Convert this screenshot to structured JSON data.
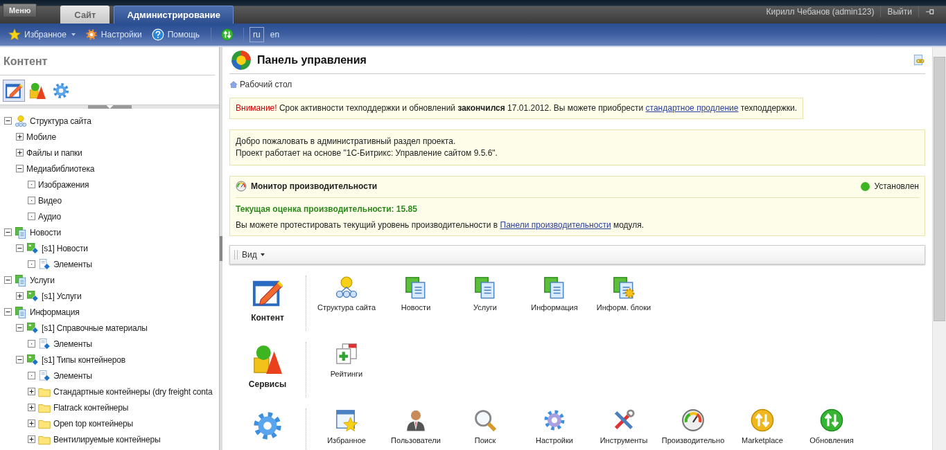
{
  "top_bar": {
    "menu_button": "Меню",
    "tabs": [
      {
        "label": "Сайт",
        "selected": false
      },
      {
        "label": "Администрирование",
        "selected": true
      }
    ],
    "user": "Кирилл Чебанов (admin123)",
    "logout": "Выйти"
  },
  "toolbar": {
    "items": [
      {
        "kind": "favorites",
        "label": "Избранное",
        "dropdown": true
      },
      {
        "kind": "settings",
        "label": "Настройки",
        "dropdown": false
      },
      {
        "kind": "help",
        "label": "Помощь",
        "dropdown": false
      }
    ],
    "languages": [
      {
        "label": "ru",
        "selected": true
      },
      {
        "label": "en",
        "selected": false
      }
    ]
  },
  "sidebar": {
    "title": "Контент",
    "modes": [
      {
        "kind": "content",
        "selected": true
      },
      {
        "kind": "services",
        "selected": false
      },
      {
        "kind": "settings",
        "selected": false
      }
    ],
    "tree": [
      {
        "label": "Структура сайта",
        "kind": "structure",
        "expanded": true,
        "children": [
          {
            "label": "Мобиле",
            "kind": "plain",
            "expanded": false
          },
          {
            "label": "Файлы и папки",
            "kind": "plain",
            "expanded": false
          },
          {
            "label": "Медиабиблиотека",
            "kind": "plain",
            "expanded": true,
            "children": [
              {
                "label": "Изображения",
                "kind": "plain",
                "leaf": true
              },
              {
                "label": "Видео",
                "kind": "plain",
                "leaf": true
              },
              {
                "label": "Аудио",
                "kind": "plain",
                "leaf": true
              }
            ]
          }
        ]
      },
      {
        "label": "Новости",
        "kind": "iblock-type",
        "expanded": true,
        "children": [
          {
            "label": "[s1] Новости",
            "kind": "iblock",
            "expanded": true,
            "children": [
              {
                "label": "Элементы",
                "kind": "elements",
                "leaf": true
              }
            ]
          }
        ]
      },
      {
        "label": "Услуги",
        "kind": "iblock-type",
        "expanded": true,
        "children": [
          {
            "label": "[s1] Услуги",
            "kind": "iblock",
            "expanded": false
          }
        ]
      },
      {
        "label": "Информация",
        "kind": "iblock-type",
        "expanded": true,
        "children": [
          {
            "label": "[s1] Справочные материалы",
            "kind": "iblock",
            "expanded": true,
            "children": [
              {
                "label": "Элементы",
                "kind": "elements",
                "leaf": true
              }
            ]
          },
          {
            "label": "[s1] Типы контейнеров",
            "kind": "iblock",
            "expanded": true,
            "children": [
              {
                "label": "Элементы",
                "kind": "elements",
                "leaf": true
              },
              {
                "label": "Стандартные контейнеры (dry freight conta",
                "kind": "section",
                "expanded": false
              },
              {
                "label": "Flatrack контейнеры",
                "kind": "section",
                "expanded": false
              },
              {
                "label": "Open top контейнеры",
                "kind": "section",
                "expanded": false
              },
              {
                "label": "Вентилируемые контейнеры",
                "kind": "section",
                "expanded": false
              }
            ]
          }
        ]
      }
    ]
  },
  "main": {
    "title": "Панель управления",
    "breadcrumb": "Рабочий стол",
    "warning": {
      "label": "Внимание!",
      "text": "Срок активности техподдержки и обновлений **закончился** 17.01.2012. Вы можете приобрести",
      "link": "стандартное продление",
      "text_after": "техподдержки."
    },
    "welcome": [
      "Добро пожаловать в административный раздел проекта.",
      "Проект работает на основе \"1С-Битрикс: Управление сайтом 9.5.6\"."
    ],
    "monitor": {
      "title": "Монитор производительности",
      "status": "Установлен",
      "score": "Текущая оценка производительности: 15.85",
      "text": "Вы можете протестировать текущий уровень производительности в",
      "link": "Панели производительности",
      "text_after": "модуля."
    },
    "view_menu": "Вид",
    "sections": [
      {
        "kind": "content",
        "label": "Контент",
        "tiles": [
          {
            "kind": "structure",
            "label": "Структура сайта"
          },
          {
            "kind": "iblock-type",
            "label": "Новости"
          },
          {
            "kind": "iblock-type",
            "label": "Услуги"
          },
          {
            "kind": "iblock-type",
            "label": "Информация"
          },
          {
            "kind": "iblock-settings",
            "label": "Информ. блоки"
          }
        ]
      },
      {
        "kind": "services",
        "label": "Сервисы",
        "tiles": [
          {
            "kind": "rating",
            "label": "Рейтинги"
          }
        ]
      },
      {
        "kind": "settings",
        "tiles": [
          {
            "kind": "favorites",
            "label": "Избранное"
          },
          {
            "kind": "users",
            "label": "Пользователи"
          },
          {
            "kind": "search",
            "label": "Поиск"
          },
          {
            "kind": "settings",
            "label": "Настройки"
          },
          {
            "kind": "tools",
            "label": "Инструменты"
          },
          {
            "kind": "performance",
            "label": "Производительно"
          },
          {
            "kind": "marketplace",
            "label": "Marketplace"
          },
          {
            "kind": "updates",
            "label": "Обновления"
          }
        ]
      }
    ]
  }
}
